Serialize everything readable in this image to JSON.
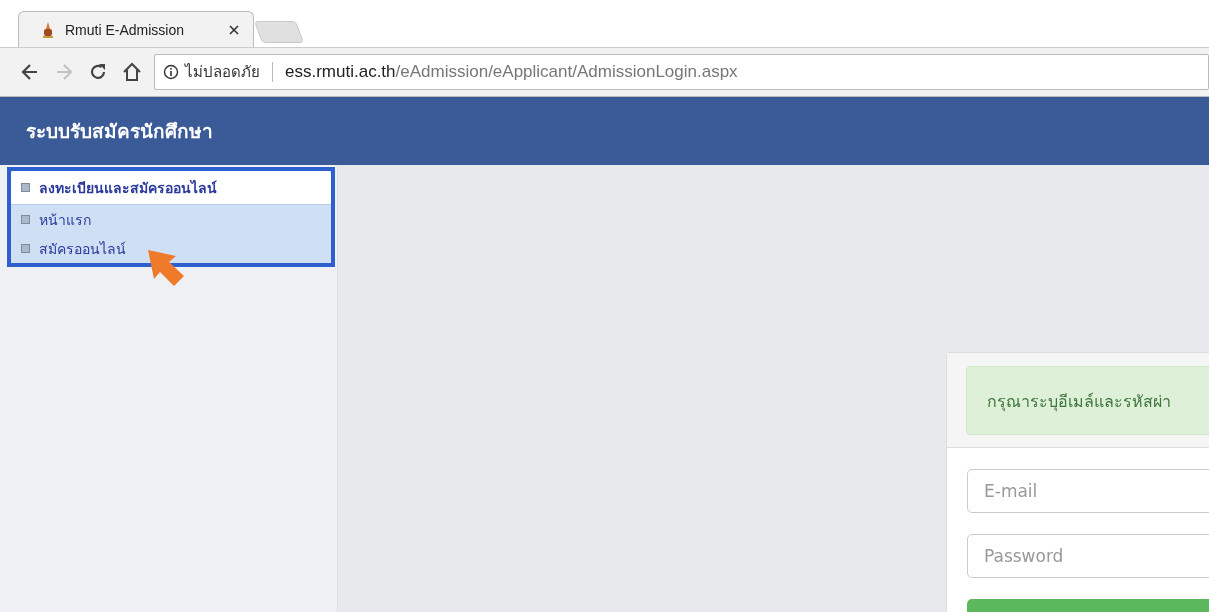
{
  "browser": {
    "tabs": [
      {
        "title": "Rmuti E-Admission",
        "selected": true
      }
    ],
    "nav": [
      {
        "kind": "back",
        "disabled": false
      },
      {
        "kind": "forward",
        "disabled": true
      },
      {
        "kind": "reload",
        "disabled": false
      },
      {
        "kind": "home",
        "disabled": false
      }
    ],
    "address": {
      "security": "ไม่ปลอดภัย",
      "host": "ess.rmuti.ac.th",
      "path": "/eAdmission/eApplicant/AdmissionLogin.aspx"
    }
  },
  "header": {
    "title": "ระบบรับสมัครนักศึกษา"
  },
  "sidebar": {
    "items": [
      {
        "label": "ลงทะเบียนและสมัครออนไลน์",
        "kind": "header"
      },
      {
        "label": "หน้าแรก",
        "kind": "link"
      },
      {
        "label": "สมัครออนไลน์",
        "kind": "link"
      }
    ]
  },
  "login": {
    "alert": "กรุณาระบุอีเมล์และรหัสผ่า",
    "email": {
      "placeholder": "E-mail"
    },
    "password": {
      "placeholder": "Password"
    }
  }
}
